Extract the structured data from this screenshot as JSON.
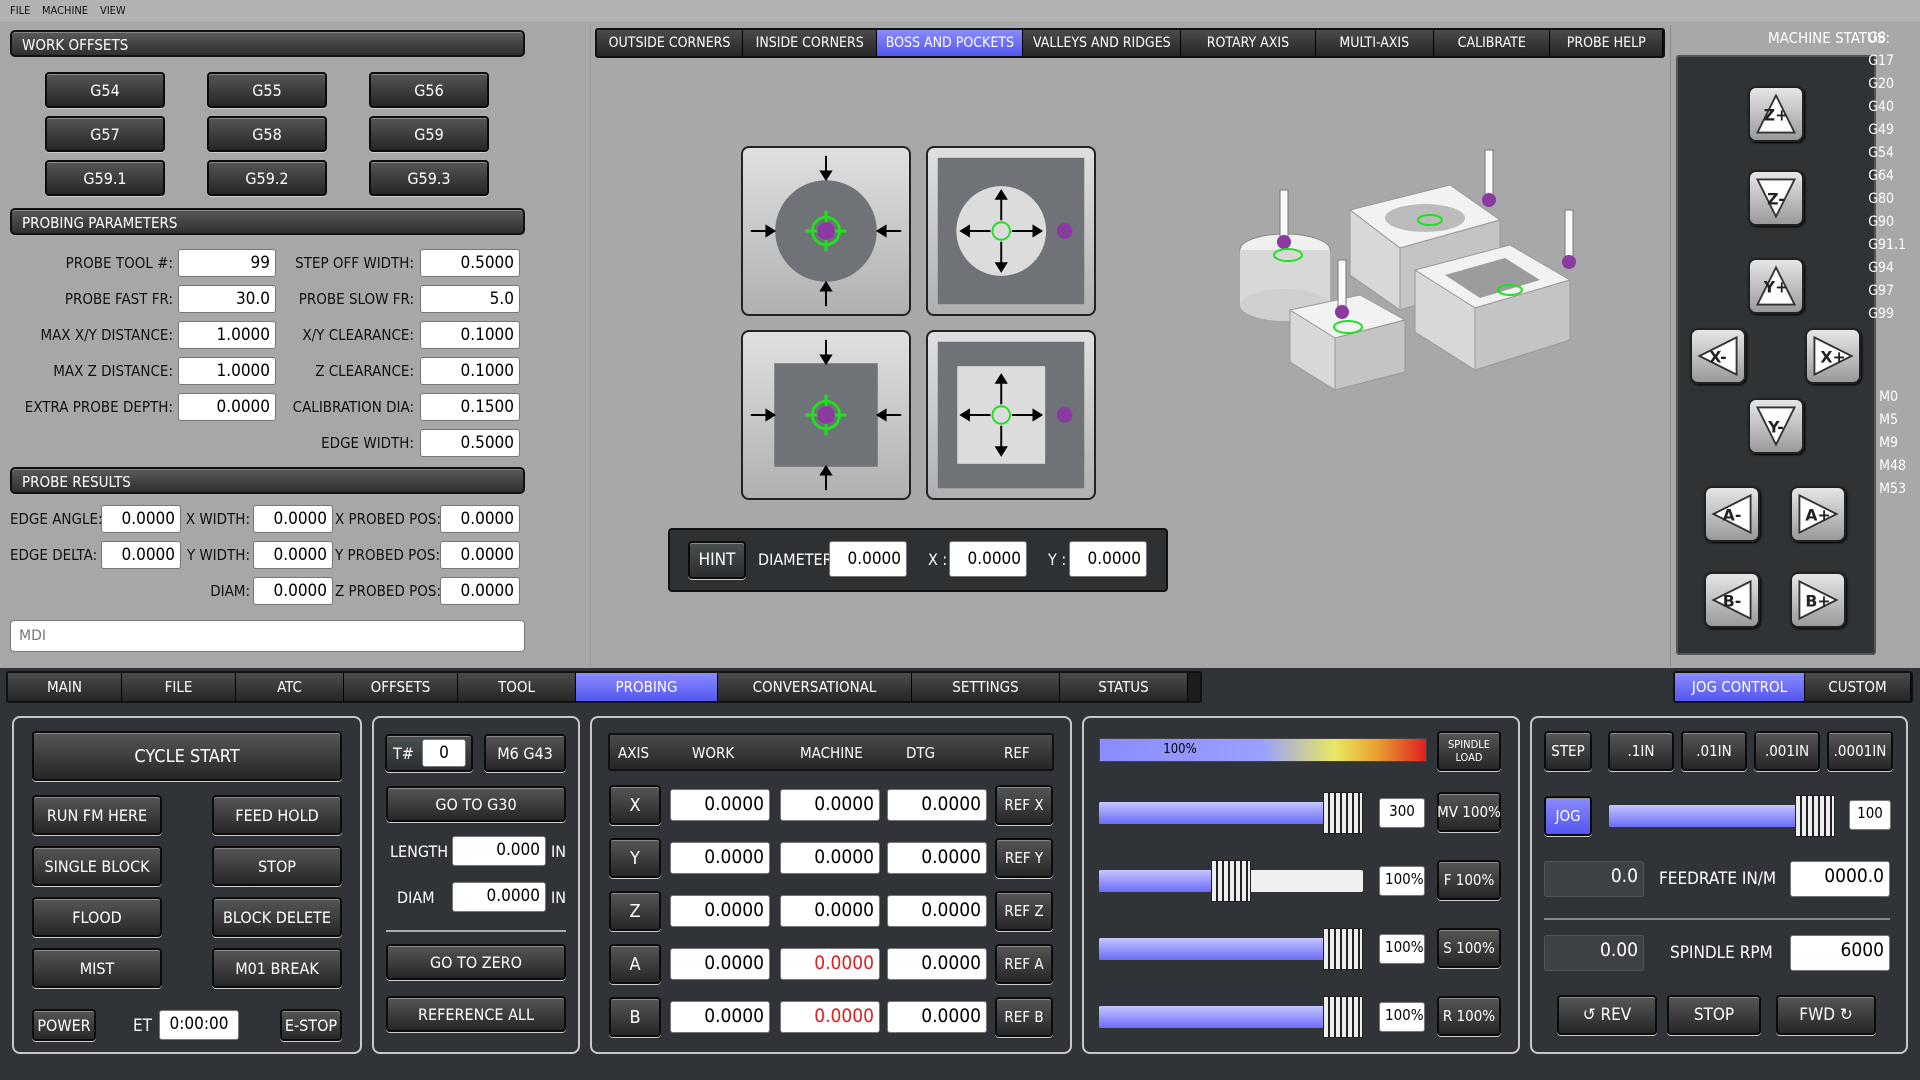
{
  "menu": {
    "file": "FILE",
    "machine": "MACHINE",
    "view": "VIEW"
  },
  "work_offsets": {
    "title": "WORK OFFSETS",
    "buttons": [
      "G54",
      "G55",
      "G56",
      "G57",
      "G58",
      "G59",
      "G59.1",
      "G59.2",
      "G59.3"
    ]
  },
  "probing_params": {
    "title": "PROBING PARAMETERS",
    "left": [
      {
        "label": "PROBE TOOL #:",
        "value": "99"
      },
      {
        "label": "PROBE FAST FR:",
        "value": "30.0"
      },
      {
        "label": "MAX X/Y DISTANCE:",
        "value": "1.0000"
      },
      {
        "label": "MAX Z DISTANCE:",
        "value": "1.0000"
      },
      {
        "label": "EXTRA PROBE DEPTH:",
        "value": "0.0000"
      }
    ],
    "right": [
      {
        "label": "STEP OFF WIDTH:",
        "value": "0.5000"
      },
      {
        "label": "PROBE SLOW FR:",
        "value": "5.0"
      },
      {
        "label": "X/Y CLEARANCE:",
        "value": "0.1000"
      },
      {
        "label": "Z CLEARANCE:",
        "value": "0.1000"
      },
      {
        "label": "CALIBRATION DIA:",
        "value": "0.1500"
      },
      {
        "label": "EDGE WIDTH:",
        "value": "0.5000"
      }
    ]
  },
  "probe_results": {
    "title": "PROBE RESULTS",
    "edge_angle_label": "EDGE ANGLE:",
    "edge_angle": "0.0000",
    "edge_delta_label": "EDGE DELTA:",
    "edge_delta": "0.0000",
    "x_width_label": "X WIDTH:",
    "x_width": "0.0000",
    "y_width_label": "Y WIDTH:",
    "y_width": "0.0000",
    "diam_label": "DIAM:",
    "diam": "0.0000",
    "x_probed_label": "X PROBED POS:",
    "x_probed": "0.0000",
    "y_probed_label": "Y PROBED POS:",
    "y_probed": "0.0000",
    "z_probed_label": "Z PROBED POS:",
    "z_probed": "0.0000"
  },
  "mdi": {
    "placeholder": "MDI"
  },
  "probe_tabs": [
    "OUTSIDE CORNERS",
    "INSIDE CORNERS",
    "BOSS AND POCKETS",
    "VALLEYS AND RIDGES",
    "ROTARY AXIS",
    "MULTI-AXIS",
    "CALIBRATE",
    "PROBE HELP"
  ],
  "probe_tab_active": 2,
  "hint_bar": {
    "hint": "HINT",
    "diameter_label": "DIAMETER:",
    "diameter": "0.0000",
    "x_label": "X :",
    "x": "0.0000",
    "y_label": "Y :",
    "y": "0.0000"
  },
  "machine_status": {
    "title": "MACHINE STATUS:",
    "gcodes": [
      "G8",
      "G17",
      "G20",
      "G40",
      "G49",
      "G54",
      "G64",
      "G80",
      "G90",
      "G91.1",
      "G94",
      "G97",
      "G99"
    ],
    "mcodes": [
      "M0",
      "M5",
      "M9",
      "M48",
      "M53"
    ]
  },
  "jog_buttons": {
    "zplus": "Z+",
    "zminus": "Z-",
    "yplus": "Y+",
    "yminus": "Y-",
    "xminus": "X-",
    "xplus": "X+",
    "aminus": "A-",
    "aplus": "A+",
    "bminus": "B-",
    "bplus": "B+"
  },
  "main_tabs": [
    "MAIN",
    "FILE",
    "ATC",
    "OFFSETS",
    "TOOL",
    "PROBING",
    "CONVERSATIONAL",
    "SETTINGS",
    "STATUS"
  ],
  "main_tab_active": 5,
  "right_tabs": [
    "JOG CONTROL",
    "CUSTOM"
  ],
  "right_tab_active": 0,
  "cycle": {
    "cycle_start": "CYCLE START",
    "run_fm_here": "RUN FM HERE",
    "feed_hold": "FEED HOLD",
    "single_block": "SINGLE BLOCK",
    "stop": "STOP",
    "flood": "FLOOD",
    "block_delete": "BLOCK DELETE",
    "mist": "MIST",
    "m01_break": "M01 BREAK",
    "power": "POWER",
    "et_label": "ET",
    "et_value": "0:00:00",
    "estop": "E-STOP"
  },
  "tool": {
    "t_label": "T#",
    "t_value": "0",
    "m6g43": "M6 G43",
    "go_g30": "GO TO G30",
    "length_label": "LENGTH",
    "length": "0.000",
    "length_unit": "IN",
    "diam_label": "DIAM",
    "diam": "0.0000",
    "diam_unit": "IN",
    "go_zero": "GO TO ZERO",
    "ref_all": "REFERENCE ALL"
  },
  "dro": {
    "headers": [
      "AXIS",
      "WORK",
      "MACHINE",
      "DTG",
      "REF"
    ],
    "rows": [
      {
        "axis": "X",
        "work": "0.0000",
        "machine": "0.0000",
        "dtg": "0.0000",
        "ref": "REF X"
      },
      {
        "axis": "Y",
        "work": "0.0000",
        "machine": "0.0000",
        "dtg": "0.0000",
        "ref": "REF Y"
      },
      {
        "axis": "Z",
        "work": "0.0000",
        "machine": "0.0000",
        "dtg": "0.0000",
        "ref": "REF Z"
      },
      {
        "axis": "A",
        "work": "0.0000",
        "machine": "0.0000",
        "dtg": "0.0000",
        "ref": "REF A"
      },
      {
        "axis": "B",
        "work": "0.0000",
        "machine": "0.0000",
        "dtg": "0.0000",
        "ref": "REF B"
      }
    ]
  },
  "overrides": {
    "spindle_load_pct": "100%",
    "spindle_load_label": "SPINDLE LOAD",
    "rows": [
      {
        "value": "300",
        "button": "MV 100%",
        "fill": 0.95
      },
      {
        "value": "100%",
        "button": "F 100%",
        "fill": 0.5
      },
      {
        "value": "100%",
        "button": "S 100%",
        "fill": 0.95
      },
      {
        "value": "100%",
        "button": "R 100%",
        "fill": 0.95
      }
    ]
  },
  "jog": {
    "step": "STEP",
    "increments": [
      ".1IN",
      ".01IN",
      ".001IN",
      ".0001IN"
    ],
    "jog": "JOG",
    "jog_value": "100",
    "feed_actual": "0.0",
    "feed_label": "FEEDRATE IN/M",
    "feed_set": "0000.0",
    "spindle_actual": "0.00",
    "spindle_label": "SPINDLE RPM",
    "spindle_set": "6000",
    "rev": "REV",
    "stop": "STOP",
    "fwd": "FWD"
  },
  "colors": {
    "accent": "#5355ee",
    "red_value": "#e02020",
    "green": "#20e020"
  }
}
